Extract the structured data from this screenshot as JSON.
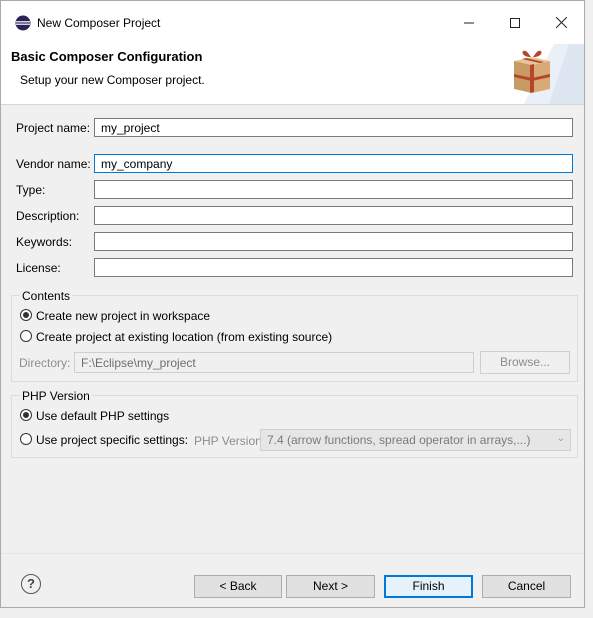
{
  "window": {
    "title": "New Composer Project",
    "controls": {
      "minimize": "—",
      "maximize": "☐",
      "close": "✕"
    }
  },
  "banner": {
    "title": "Basic Composer Configuration",
    "subtitle": "Setup your new Composer project."
  },
  "fields": [
    {
      "label": "Project name:",
      "value": "my_project"
    },
    {
      "label": "Vendor name:",
      "value": "my_company"
    },
    {
      "label": "Type:",
      "value": ""
    },
    {
      "label": "Description:",
      "value": ""
    },
    {
      "label": "Keywords:",
      "value": ""
    },
    {
      "label": "License:",
      "value": ""
    }
  ],
  "contents": {
    "group_title": "Contents",
    "options": [
      {
        "label": "Create new project in workspace",
        "checked": true
      },
      {
        "label": "Create project at existing location (from existing source)",
        "checked": false
      }
    ],
    "directory_label": "Directory:",
    "directory_value": "F:\\Eclipse\\my_project",
    "browse_label": "Browse..."
  },
  "php": {
    "group_title": "PHP Version",
    "options": [
      {
        "label": "Use default PHP settings",
        "checked": true
      },
      {
        "label": "Use project specific settings:",
        "checked": false
      }
    ],
    "version_label": "PHP Version:",
    "version_value": "7.4 (arrow functions, spread operator in arrays,...)"
  },
  "buttons": {
    "back": "< Back",
    "next": "Next >",
    "finish": "Finish",
    "cancel": "Cancel",
    "help": "?"
  },
  "icons": {
    "app": "eclipse-icon",
    "package": "package-icon",
    "help": "help-icon"
  },
  "colors": {
    "accent": "#0078d7",
    "dialog_bg": "#f0f0f0",
    "banner_bg": "#ffffff"
  }
}
